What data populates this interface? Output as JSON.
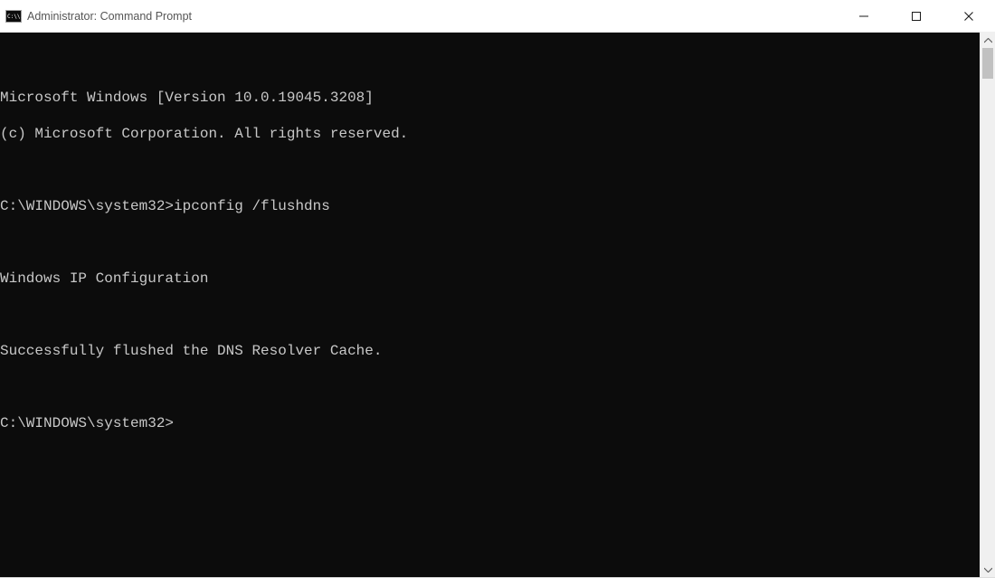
{
  "window": {
    "title": "Administrator: Command Prompt"
  },
  "terminal": {
    "lines": [
      "Microsoft Windows [Version 10.0.19045.3208]",
      "(c) Microsoft Corporation. All rights reserved.",
      "",
      "C:\\WINDOWS\\system32>ipconfig /flushdns",
      "",
      "Windows IP Configuration",
      "",
      "Successfully flushed the DNS Resolver Cache.",
      "",
      "C:\\WINDOWS\\system32>"
    ]
  },
  "icons": {
    "cmd": "cmd-icon",
    "minimize": "minimize-icon",
    "maximize": "maximize-icon",
    "close": "close-icon",
    "scroll_up": "chevron-up-icon",
    "scroll_down": "chevron-down-icon"
  }
}
